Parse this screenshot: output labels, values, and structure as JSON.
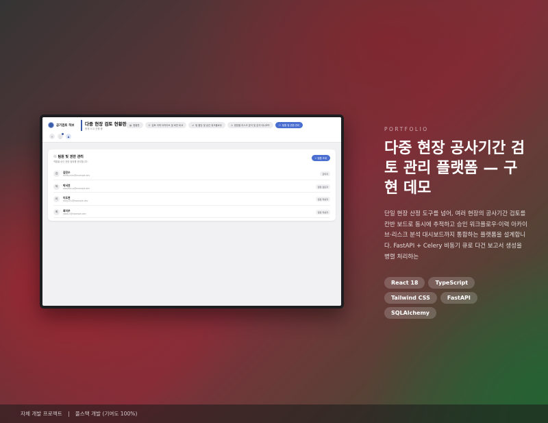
{
  "app": {
    "brand": "공기검토 허브",
    "title": "다중 현장 검토 현황판",
    "subtitle": "현재 사고 진행 중"
  },
  "tabs": [
    {
      "icon": "▦",
      "label": "현황판",
      "active": false
    },
    {
      "icon": "⊟",
      "label": "검토 이력 아카이브 및 버전 비교",
      "active": false
    },
    {
      "icon": "⇄",
      "label": "팀 할당 및 승인 워크플로우",
      "active": false
    },
    {
      "icon": "◔",
      "label": "현장별 리스크 분석 및 분석 대시보드",
      "active": false
    },
    {
      "icon": "⚇",
      "label": "팀원 및 권한 관리",
      "active": true
    }
  ],
  "header_icons": [
    {
      "name": "sun-icon",
      "glyph": "☼",
      "active": false,
      "dot": false
    },
    {
      "name": "bell-icon",
      "glyph": "◌",
      "active": false,
      "dot": true
    },
    {
      "name": "user-icon",
      "glyph": "♟",
      "active": true,
      "dot": false
    }
  ],
  "panel": {
    "icon": "⚇",
    "title": "팀원 및 권한 관리",
    "subtitle": "역할을 승인 권한 범위를 관리합니다.",
    "invite_button": "팀원 초대"
  },
  "members": [
    {
      "initial": "김",
      "name": "김민수",
      "email": "minsu.kim@example.dev",
      "role": "관리자"
    },
    {
      "initial": "박",
      "name": "박서연",
      "email": "seoyeon.p@example.dev",
      "role": "일정 검토자"
    },
    {
      "initial": "이",
      "name": "이도현",
      "email": "dohyun.l@example.dev",
      "role": "일정 작성자"
    },
    {
      "initial": "최",
      "name": "최지우",
      "email": "jiwoo.c@example.dev",
      "role": "일정 작성자"
    }
  ],
  "showcase": {
    "label": "PORTFOLIO",
    "headline": "다중 현장 공사기간 검토 관리 플랫폼 — 구현 데모",
    "description": "단일 현장 산정 도구를 넘어, 여러 현장의 공사기간 검토를 칸반 보드로 동시에 추적하고 승인 워크플로우·이력 아카이브·리스크 분석 대시보드까지 통합하는 플랫폼을 설계합니다. FastAPI + Celery 비동기 큐로 다건 보고서 생성을 병렬 처리하는",
    "tech": [
      "React 18",
      "TypeScript",
      "Tailwind CSS",
      "FastAPI",
      "SQLAlchemy"
    ]
  },
  "footer": {
    "left": "자체 개발 프로젝트",
    "right": "풀스택 개발 (기여도 100%)"
  }
}
